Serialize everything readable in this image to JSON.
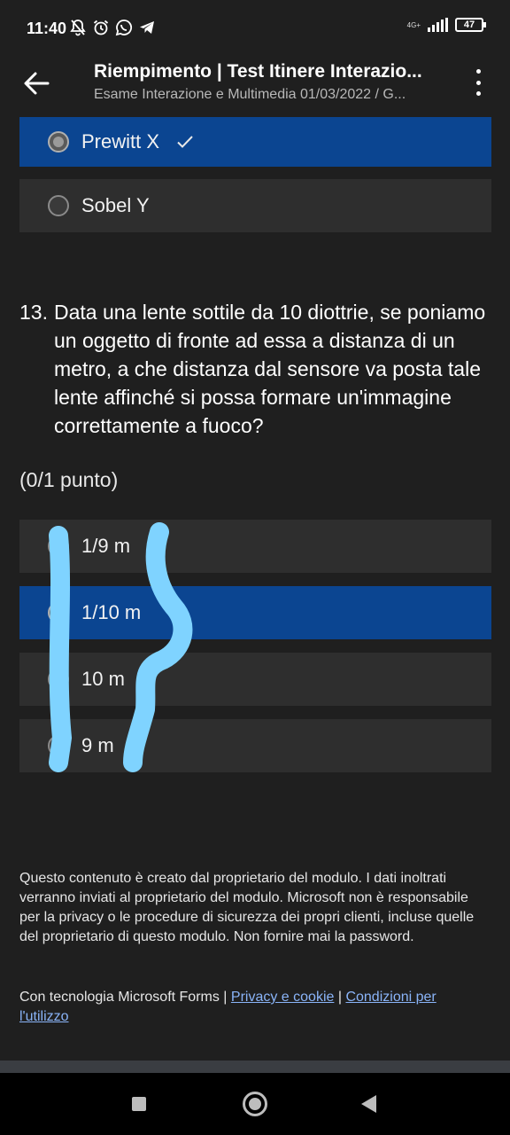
{
  "status_bar": {
    "time": "11:40",
    "network": "4G+",
    "battery": "47",
    "icons": [
      "bell-off-icon",
      "alarm-icon",
      "whatsapp-icon",
      "telegram-icon"
    ]
  },
  "header": {
    "title": "Riempimento | Test Itinere Interazio...",
    "subtitle": "Esame Interazione e Multimedia 01/03/2022 / G..."
  },
  "prev_question": {
    "options": [
      {
        "label": "Prewitt X",
        "selected": true,
        "correct_mark": true
      },
      {
        "label": "Sobel Y",
        "selected": false
      }
    ]
  },
  "question": {
    "number": "13.",
    "text": "Data una lente sottile da 10 diottrie, se poniamo un oggetto di fronte ad essa a distanza di un metro, a che distanza dal sensore va posta tale lente affinché si possa formare un'immagine correttamente a fuoco?",
    "points": "(0/1 punto)",
    "options": [
      {
        "label": "1/9 m",
        "selected": false
      },
      {
        "label": "1/10 m",
        "selected": true
      },
      {
        "label": "10 m",
        "selected": false
      },
      {
        "label": "9 m",
        "selected": false
      }
    ]
  },
  "footer": {
    "disclaimer": "Questo contenuto è creato dal proprietario del modulo. I dati inoltrati verranno inviati al proprietario del modulo. Microsoft non è responsabile per la privacy o le procedure di sicurezza dei propri clienti, incluse quelle del proprietario di questo modulo. Non fornire mai la password.",
    "powered_by": "Con tecnologia Microsoft Forms | ",
    "privacy_link": "Privacy e cookie",
    "separator": " | ",
    "terms_link": "Condizioni per l'utilizzo"
  },
  "colors": {
    "background": "#1f1f1f",
    "option_bg": "#2e2e2e",
    "selected_bg": "#0b4591",
    "link": "#8ab4f8",
    "scribble": "#7fd3ff"
  }
}
